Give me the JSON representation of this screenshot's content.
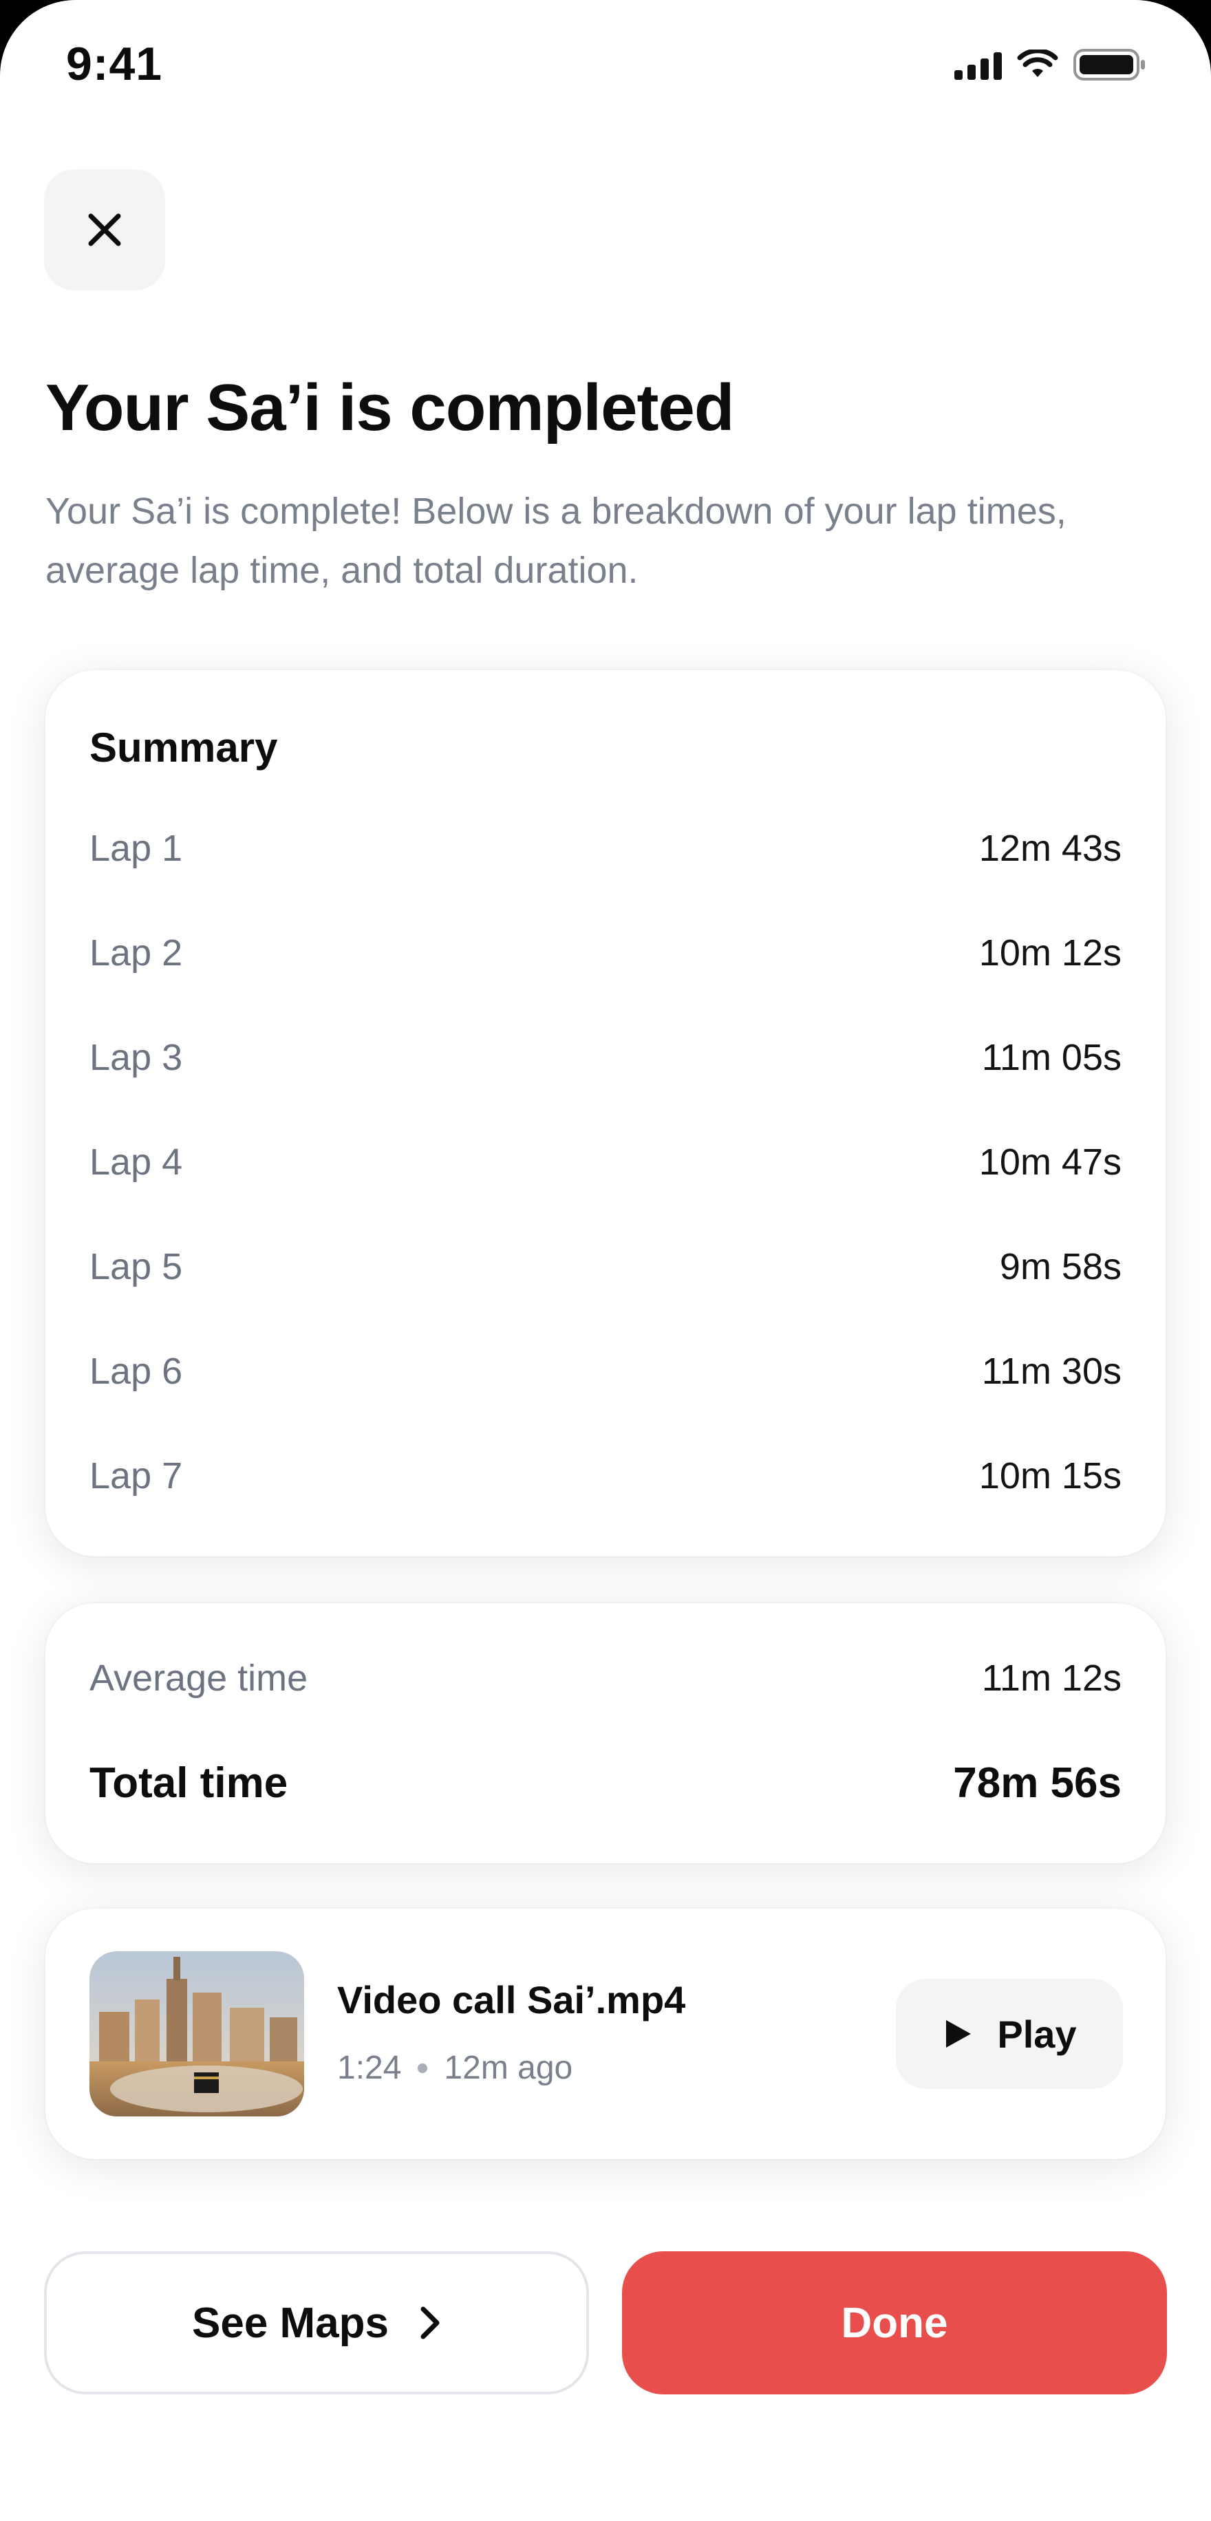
{
  "status_bar": {
    "time": "9:41"
  },
  "header": {
    "close_icon": "close-icon",
    "title": "Your Sa’i is completed",
    "subtitle": "Your Sa’i is complete! Below is a breakdown of your lap times, average lap time, and total duration."
  },
  "summary": {
    "title": "Summary",
    "laps": [
      {
        "label": "Lap 1",
        "value": "12m 43s"
      },
      {
        "label": "Lap 2",
        "value": "10m 12s"
      },
      {
        "label": "Lap 3",
        "value": "11m 05s"
      },
      {
        "label": "Lap 4",
        "value": "10m 47s"
      },
      {
        "label": "Lap 5",
        "value": "9m 58s"
      },
      {
        "label": "Lap 6",
        "value": "11m 30s"
      },
      {
        "label": "Lap 7",
        "value": "10m 15s"
      }
    ]
  },
  "totals": {
    "average_label": "Average time",
    "average_value": "11m 12s",
    "total_label": "Total time",
    "total_value": "78m 56s"
  },
  "video": {
    "name": "Video call Sai’.mp4",
    "duration": "1:24",
    "ago": "12m ago",
    "play_label": "Play",
    "play_icon": "play-icon"
  },
  "actions": {
    "maps_label": "See Maps",
    "maps_icon": "chevron-right-icon",
    "done_label": "Done"
  },
  "colors": {
    "accent": "#E84E4B",
    "muted_text": "#6E7382",
    "surface": "#F3F4F6"
  }
}
